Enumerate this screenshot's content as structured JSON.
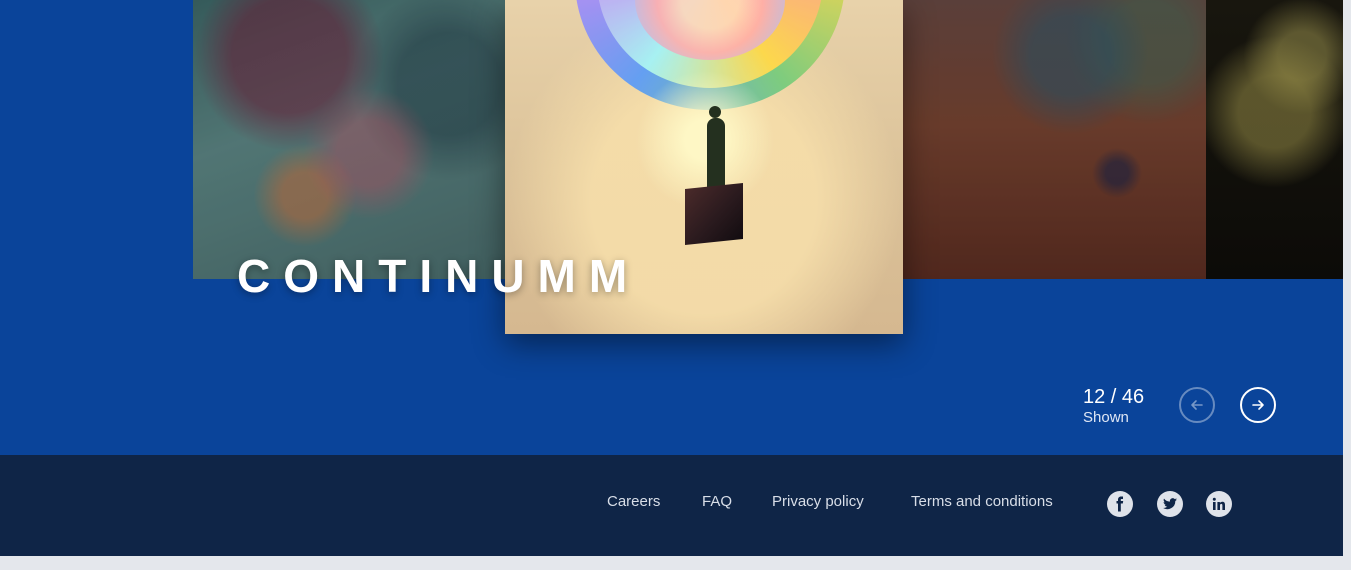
{
  "gallery": {
    "title": "CONTINUMM",
    "counter": {
      "value": "12 / 46",
      "label": "Shown"
    },
    "artworks": [
      {
        "name": "artwork-abstract-teal"
      },
      {
        "name": "artwork-featured-swirl"
      },
      {
        "name": "artwork-abstract-rust"
      },
      {
        "name": "artwork-abstract-dark-foliage"
      }
    ],
    "nav": {
      "prev_icon": "arrow-left-icon",
      "next_icon": "arrow-right-icon"
    }
  },
  "footer": {
    "links": [
      "Careers",
      "FAQ",
      "Privacy policy",
      "Terms and conditions"
    ],
    "social": [
      "facebook-icon",
      "twitter-icon",
      "linkedin-icon"
    ]
  },
  "colors": {
    "hero_background": "#0a449a",
    "footer_background": "#0f2547",
    "page_background": "#e4e7ec"
  }
}
